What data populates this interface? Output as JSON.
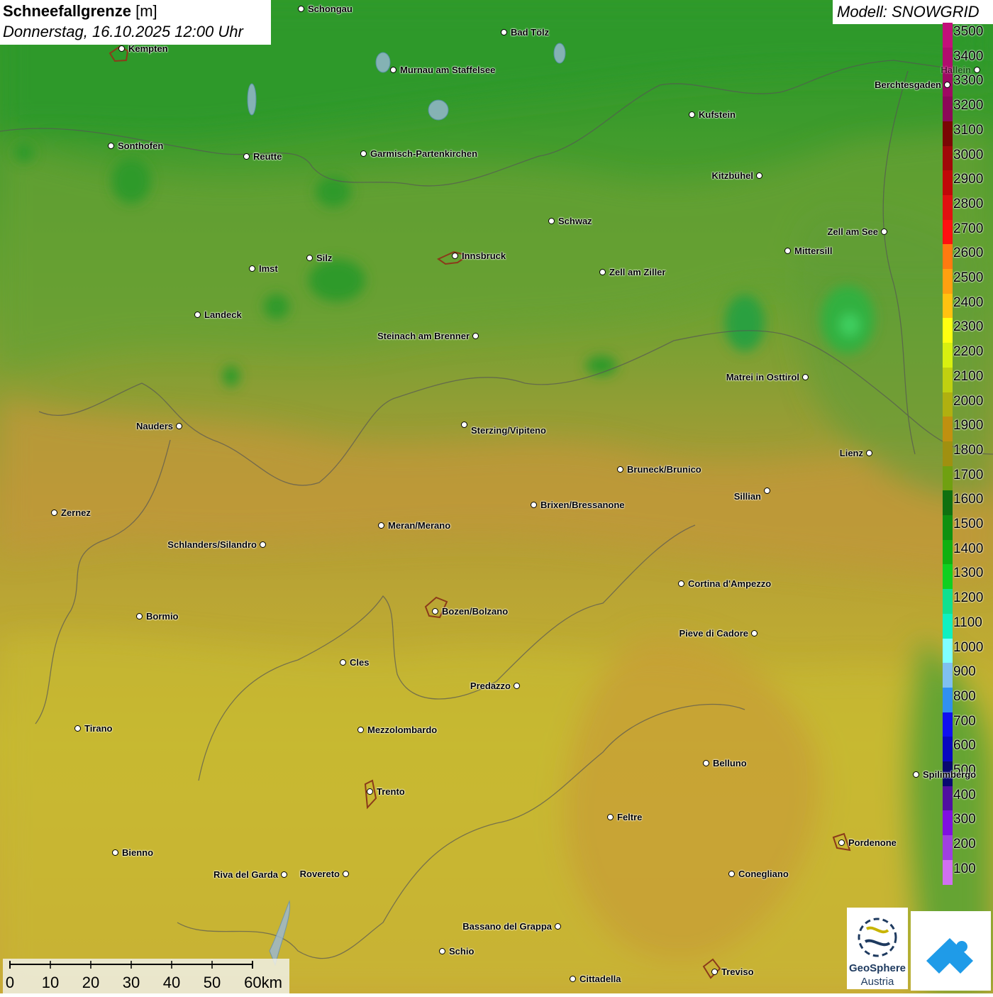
{
  "title": {
    "parameter": "Schneefallgrenze",
    "unit": "[m]",
    "datetime": "Donnerstag, 16.10.2025 12:00 Uhr"
  },
  "model": "Modell: SNOWGRID",
  "legend": {
    "labels": [
      "3500",
      "3400",
      "3300",
      "3200",
      "3100",
      "3000",
      "2900",
      "2800",
      "2700",
      "2600",
      "2500",
      "2400",
      "2300",
      "2200",
      "2100",
      "2000",
      "1900",
      "1800",
      "1700",
      "1600",
      "1500",
      "1400",
      "1300",
      "1200",
      "1100",
      "1000",
      "900",
      "800",
      "700",
      "600",
      "500",
      "400",
      "300",
      "200",
      "100"
    ],
    "colors": [
      "#c2107a",
      "#b00d6e",
      "#9e0a63",
      "#8c0858",
      "#7a0604",
      "#a00808",
      "#c00808",
      "#e01010",
      "#ff1010",
      "#ff7a10",
      "#ffa010",
      "#ffc210",
      "#ffff10",
      "#d8f010",
      "#c0d010",
      "#b0b010",
      "#c09010",
      "#a09010",
      "#70a010",
      "#107010",
      "#109010",
      "#10b010",
      "#10d020",
      "#10e090",
      "#10f0c0",
      "#80ffff",
      "#80c0f0",
      "#3090f0",
      "#1010f0",
      "#0808c0",
      "#080870",
      "#5010a0",
      "#8010e0",
      "#a040e0",
      "#d070f0"
    ]
  },
  "cities": [
    "Schongau",
    "Kempten",
    "Bad Tölz",
    "Murnau am Staffelsee",
    "Kufstein",
    "Berchtesgaden",
    "Sonthofen",
    "Reutte",
    "Garmisch-Partenkirchen",
    "Kitzbühel",
    "Schwaz",
    "Zell am See",
    "Innsbruck",
    "Mittersill",
    "Imst",
    "Silz",
    "Zell am Ziller",
    "Landeck",
    "Steinach am Brenner",
    "Matrei in Osttirol",
    "Nauders",
    "Sterzing/Vipiteno",
    "Lienz",
    "Bruneck/Brunico",
    "Sillian",
    "Zernez",
    "Brixen/Bressanone",
    "Meran/Merano",
    "Schlanders/Silandro",
    "Cortina d'Ampezzo",
    "Bozen/Bolzano",
    "Bormio",
    "Pieve di Cadore",
    "Cles",
    "Predazzo",
    "Tirano",
    "Mezzolombardo",
    "Belluno",
    "Spilimbergo",
    "Trento",
    "Feltre",
    "Pordenone",
    "Bienno",
    "Riva del Garda",
    "Rovereto",
    "Conegliano",
    "Bassano del Grappa",
    "Schio",
    "Treviso",
    "Cittadella",
    "Hallein"
  ],
  "scale_labels": [
    "0",
    "10",
    "20",
    "30",
    "40",
    "50",
    "60km"
  ],
  "logos": {
    "geosphere_1": "GeoSphere",
    "geosphere_2": "Austria"
  },
  "colors": {
    "map_green": "#3f9a2a",
    "map_yellow": "#c6b82e",
    "map_orange": "#c99535"
  }
}
